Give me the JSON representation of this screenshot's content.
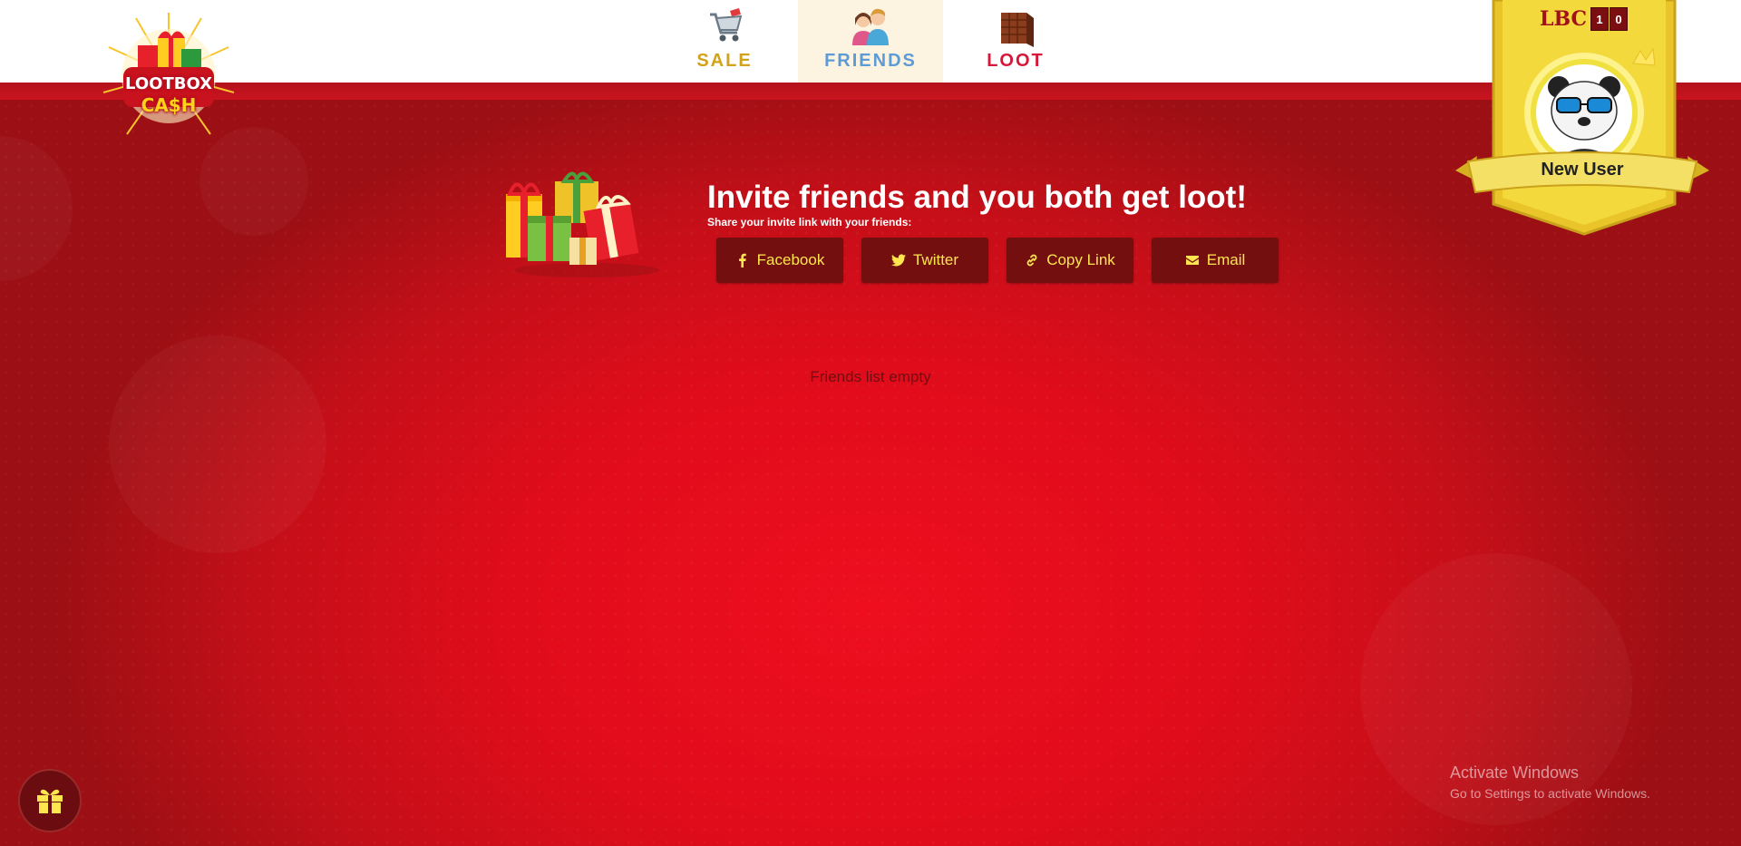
{
  "nav": {
    "items": [
      {
        "label": "SALE",
        "icon": "shopping-cart-icon",
        "color": "#d2a21a"
      },
      {
        "label": "FRIENDS",
        "icon": "friends-icon",
        "color": "#5d9bd6",
        "active": true
      },
      {
        "label": "LOOT",
        "icon": "loot-crate-icon",
        "color": "#d6173a"
      }
    ]
  },
  "logo": {
    "line1": "LOOTBOX",
    "line2": "CA$H"
  },
  "invite": {
    "title": "Invite friends and you both get loot!",
    "subtitle": "Share your invite link with your friends:",
    "buttons": [
      {
        "label": "Facebook",
        "icon": "facebook-icon"
      },
      {
        "label": "Twitter",
        "icon": "twitter-icon"
      },
      {
        "label": "Copy Link",
        "icon": "link-icon"
      },
      {
        "label": "Email",
        "icon": "email-icon"
      }
    ]
  },
  "friends": {
    "empty_text": "Friends list empty"
  },
  "profile": {
    "currency_label": "LBC",
    "balance_digits": [
      "1",
      "0"
    ],
    "username": "New User",
    "avatar": "panda-avatar"
  },
  "watermark": {
    "title": "Activate Windows",
    "subtitle": "Go to Settings to activate Windows."
  },
  "colors": {
    "accent_red": "#e00c1b",
    "button_bg": "#740f10",
    "button_text": "#ffe64e",
    "badge_gold": "#f3d93c"
  }
}
